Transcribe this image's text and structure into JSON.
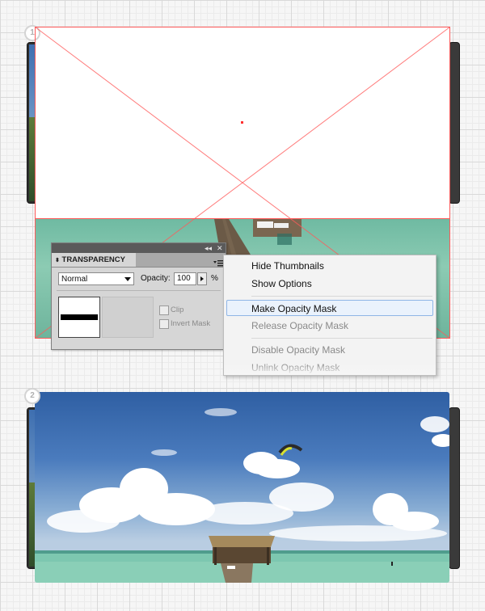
{
  "steps": {
    "step1": "1",
    "step2": "2"
  },
  "transparency_panel": {
    "title": "TRANSPARENCY",
    "collapse_glyph": "◂◂",
    "close_glyph": "✕",
    "blend_mode": "Normal",
    "opacity_label": "Opacity:",
    "opacity_value": "100",
    "opacity_unit": "%",
    "clip_label": "Clip",
    "invert_mask_label": "Invert Mask"
  },
  "flyout_menu": {
    "items": [
      {
        "label": "Hide Thumbnails",
        "enabled": true
      },
      {
        "label": "Show Options",
        "enabled": true
      },
      {
        "label": "Make Opacity Mask",
        "enabled": true,
        "highlighted": true
      },
      {
        "label": "Release Opacity Mask",
        "enabled": false
      },
      {
        "label": "Disable Opacity Mask",
        "enabled": false
      },
      {
        "label": "Unlink Opacity Mask",
        "enabled": false
      }
    ]
  },
  "colors": {
    "selection": "#ff5a5a",
    "sky": "#3f6fb0",
    "sea": "#7cc4ac",
    "menu_highlight": "#eaf2fc"
  },
  "icons": [
    "panel-menu-icon",
    "dropdown-arrow-icon",
    "stepper-arrow-icon",
    "close-icon",
    "collapse-icon"
  ]
}
